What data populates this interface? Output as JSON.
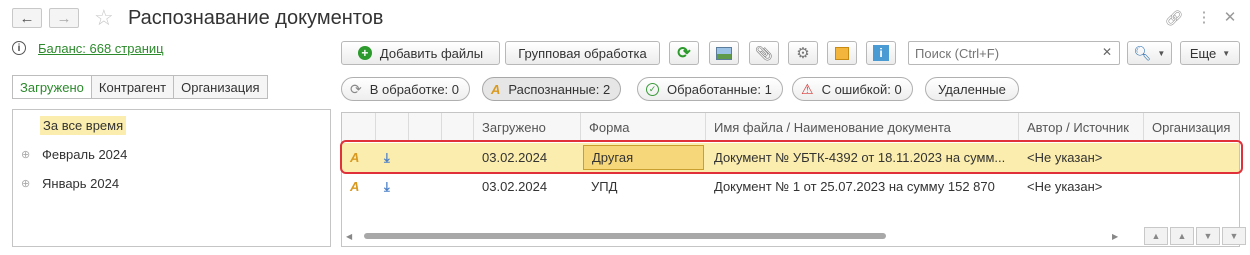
{
  "window": {
    "title": "Распознавание документов"
  },
  "balance": {
    "text": "Баланс: 668 страниц"
  },
  "tabs": [
    "Загружено",
    "Контрагент",
    "Организация"
  ],
  "tree": {
    "items": [
      {
        "label": "За все время",
        "selected": true,
        "expandable": false
      },
      {
        "label": "Февраль 2024",
        "selected": false,
        "expandable": true
      },
      {
        "label": "Январь 2024",
        "selected": false,
        "expandable": true
      }
    ]
  },
  "toolbar": {
    "add_files_label": "Добавить файлы",
    "batch_label": "Групповая обработка",
    "search_placeholder": "Поиск (Ctrl+F)",
    "more_label": "Еще"
  },
  "filters": [
    {
      "label": "В обработке: 0",
      "icon": "refresh-icon"
    },
    {
      "label": "Распознанные: 2",
      "icon": "recognized-icon"
    },
    {
      "label": "Обработанные: 1",
      "icon": "check-circle-icon"
    },
    {
      "label": "С ошибкой: 0",
      "icon": "warning-icon"
    },
    {
      "label": "Удаленные",
      "icon": ""
    }
  ],
  "grid": {
    "columns": [
      "Загружено",
      "Форма",
      "Имя файла / Наименование документа",
      "Автор / Источник",
      "Организация"
    ],
    "rows": [
      {
        "date": "03.02.2024",
        "form": "Другая",
        "name": "Документ № УБТК-4392 от 18.11.2023 на сумм...",
        "author": "<Не указан>",
        "org": "",
        "selected": true
      },
      {
        "date": "03.02.2024",
        "form": "УПД",
        "name": "Документ № 1 от 25.07.2023 на сумму 152 870",
        "author": "<Не указан>",
        "org": "",
        "selected": false
      }
    ]
  },
  "colors": {
    "accent_green": "#2c8a2c",
    "selection_yellow": "#fbedad",
    "highlight_red": "#e0313b"
  }
}
